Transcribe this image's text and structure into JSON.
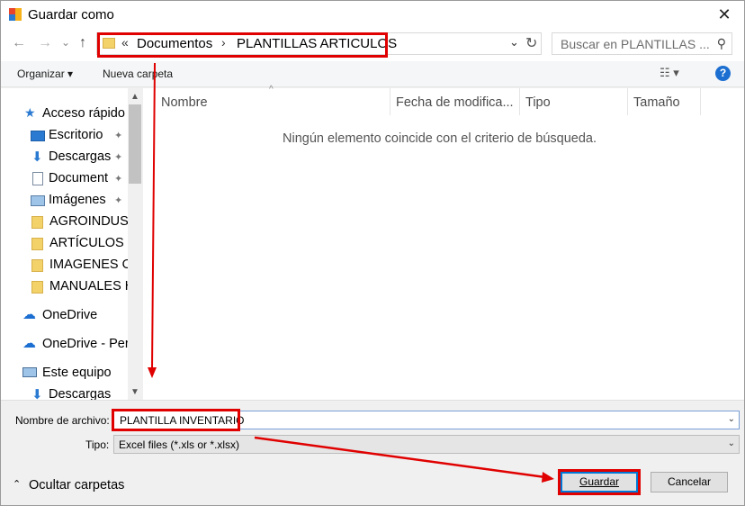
{
  "window": {
    "title": "Guardar como",
    "close_glyph": "✕"
  },
  "nav": {
    "back_glyph": "←",
    "forward_glyph": "→",
    "recent_glyph": "⌄",
    "up_glyph": "↑"
  },
  "address": {
    "overflow": "«",
    "segments": [
      "Documentos",
      "PLANTILLAS ARTICULOS"
    ],
    "separator": "›",
    "drop_glyph": "⌄",
    "refresh_glyph": "↻"
  },
  "search": {
    "placeholder": "Buscar en PLANTILLAS ...",
    "icon_glyph": "⚲"
  },
  "toolbar": {
    "organize": "Organizar ▾",
    "new_folder": "Nueva carpeta",
    "view_glyph": "☷ ▾",
    "help": "?"
  },
  "sidebar": {
    "items": [
      {
        "label": "Acceso rápido",
        "icon": "star-icon"
      },
      {
        "label": "Escritorio",
        "icon": "desktop-icon",
        "pinned": true
      },
      {
        "label": "Descargas",
        "icon": "download-icon",
        "pinned": true
      },
      {
        "label": "Document",
        "icon": "document-icon",
        "pinned": true
      },
      {
        "label": "Imágenes",
        "icon": "pictures-icon",
        "pinned": true
      },
      {
        "label": "AGROINDUST",
        "icon": "folder-icon"
      },
      {
        "label": "ARTÍCULOS",
        "icon": "folder-icon"
      },
      {
        "label": "IMAGENES O",
        "icon": "folder-icon"
      },
      {
        "label": "MANUALES H",
        "icon": "folder-icon"
      },
      {
        "label": "OneDrive",
        "icon": "cloud-icon"
      },
      {
        "label": "OneDrive - Per",
        "icon": "cloud-icon"
      },
      {
        "label": "Este equipo",
        "icon": "computer-icon"
      },
      {
        "label": "Descargas",
        "icon": "download-icon"
      }
    ],
    "pin_glyph": "📌",
    "scroll_up": "▲",
    "scroll_down": "▼"
  },
  "files": {
    "columns": [
      "Nombre",
      "Fecha de modifica...",
      "Tipo",
      "Tamaño"
    ],
    "sort_glyph": "^",
    "empty_message": "Ningún elemento coincide con el criterio de búsqueda."
  },
  "form": {
    "filename_label": "Nombre de archivo:",
    "filename_value": "PLANTILLA INVENTARIO",
    "type_label": "Tipo:",
    "type_value": "Excel files (*.xls or *.xlsx)",
    "drop_glyph": "⌄"
  },
  "footer": {
    "hide_folders": "Ocultar carpetas",
    "hide_glyph": "⌃",
    "save": "Guardar",
    "cancel": "Cancelar"
  },
  "annotations": {
    "highlight_color": "#e00000"
  }
}
